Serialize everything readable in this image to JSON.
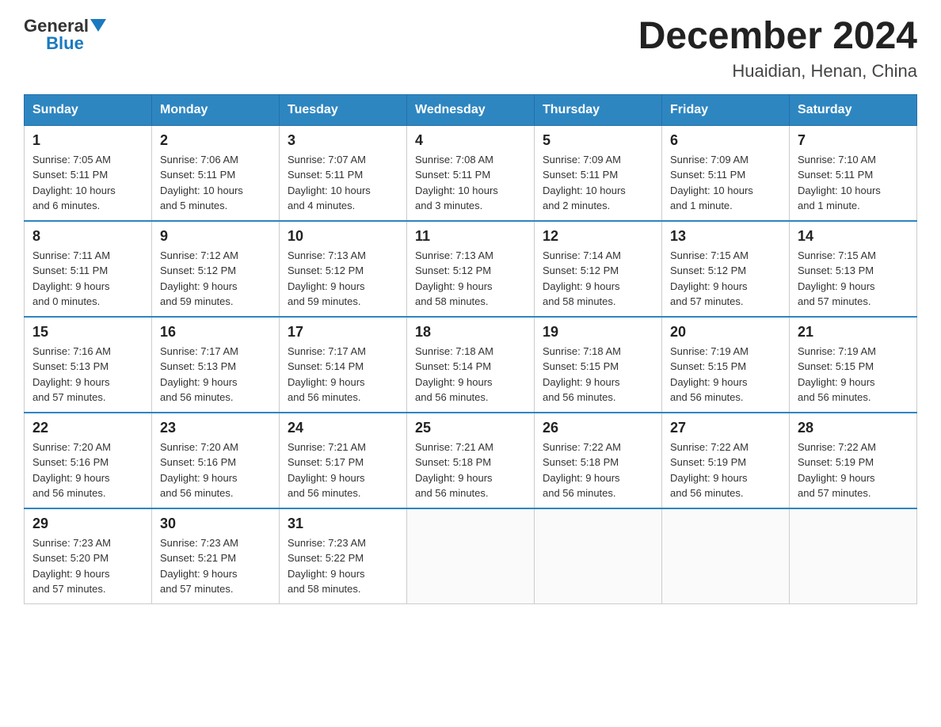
{
  "header": {
    "logo_general": "General",
    "logo_blue": "Blue",
    "title": "December 2024",
    "subtitle": "Huaidian, Henan, China"
  },
  "days_of_week": [
    "Sunday",
    "Monday",
    "Tuesday",
    "Wednesday",
    "Thursday",
    "Friday",
    "Saturday"
  ],
  "weeks": [
    [
      {
        "day": "1",
        "sunrise": "7:05 AM",
        "sunset": "5:11 PM",
        "daylight": "10 hours and 6 minutes."
      },
      {
        "day": "2",
        "sunrise": "7:06 AM",
        "sunset": "5:11 PM",
        "daylight": "10 hours and 5 minutes."
      },
      {
        "day": "3",
        "sunrise": "7:07 AM",
        "sunset": "5:11 PM",
        "daylight": "10 hours and 4 minutes."
      },
      {
        "day": "4",
        "sunrise": "7:08 AM",
        "sunset": "5:11 PM",
        "daylight": "10 hours and 3 minutes."
      },
      {
        "day": "5",
        "sunrise": "7:09 AM",
        "sunset": "5:11 PM",
        "daylight": "10 hours and 2 minutes."
      },
      {
        "day": "6",
        "sunrise": "7:09 AM",
        "sunset": "5:11 PM",
        "daylight": "10 hours and 1 minute."
      },
      {
        "day": "7",
        "sunrise": "7:10 AM",
        "sunset": "5:11 PM",
        "daylight": "10 hours and 1 minute."
      }
    ],
    [
      {
        "day": "8",
        "sunrise": "7:11 AM",
        "sunset": "5:11 PM",
        "daylight": "9 hours and 0 minutes."
      },
      {
        "day": "9",
        "sunrise": "7:12 AM",
        "sunset": "5:12 PM",
        "daylight": "9 hours and 59 minutes."
      },
      {
        "day": "10",
        "sunrise": "7:13 AM",
        "sunset": "5:12 PM",
        "daylight": "9 hours and 59 minutes."
      },
      {
        "day": "11",
        "sunrise": "7:13 AM",
        "sunset": "5:12 PM",
        "daylight": "9 hours and 58 minutes."
      },
      {
        "day": "12",
        "sunrise": "7:14 AM",
        "sunset": "5:12 PM",
        "daylight": "9 hours and 58 minutes."
      },
      {
        "day": "13",
        "sunrise": "7:15 AM",
        "sunset": "5:12 PM",
        "daylight": "9 hours and 57 minutes."
      },
      {
        "day": "14",
        "sunrise": "7:15 AM",
        "sunset": "5:13 PM",
        "daylight": "9 hours and 57 minutes."
      }
    ],
    [
      {
        "day": "15",
        "sunrise": "7:16 AM",
        "sunset": "5:13 PM",
        "daylight": "9 hours and 57 minutes."
      },
      {
        "day": "16",
        "sunrise": "7:17 AM",
        "sunset": "5:13 PM",
        "daylight": "9 hours and 56 minutes."
      },
      {
        "day": "17",
        "sunrise": "7:17 AM",
        "sunset": "5:14 PM",
        "daylight": "9 hours and 56 minutes."
      },
      {
        "day": "18",
        "sunrise": "7:18 AM",
        "sunset": "5:14 PM",
        "daylight": "9 hours and 56 minutes."
      },
      {
        "day": "19",
        "sunrise": "7:18 AM",
        "sunset": "5:15 PM",
        "daylight": "9 hours and 56 minutes."
      },
      {
        "day": "20",
        "sunrise": "7:19 AM",
        "sunset": "5:15 PM",
        "daylight": "9 hours and 56 minutes."
      },
      {
        "day": "21",
        "sunrise": "7:19 AM",
        "sunset": "5:15 PM",
        "daylight": "9 hours and 56 minutes."
      }
    ],
    [
      {
        "day": "22",
        "sunrise": "7:20 AM",
        "sunset": "5:16 PM",
        "daylight": "9 hours and 56 minutes."
      },
      {
        "day": "23",
        "sunrise": "7:20 AM",
        "sunset": "5:16 PM",
        "daylight": "9 hours and 56 minutes."
      },
      {
        "day": "24",
        "sunrise": "7:21 AM",
        "sunset": "5:17 PM",
        "daylight": "9 hours and 56 minutes."
      },
      {
        "day": "25",
        "sunrise": "7:21 AM",
        "sunset": "5:18 PM",
        "daylight": "9 hours and 56 minutes."
      },
      {
        "day": "26",
        "sunrise": "7:22 AM",
        "sunset": "5:18 PM",
        "daylight": "9 hours and 56 minutes."
      },
      {
        "day": "27",
        "sunrise": "7:22 AM",
        "sunset": "5:19 PM",
        "daylight": "9 hours and 56 minutes."
      },
      {
        "day": "28",
        "sunrise": "7:22 AM",
        "sunset": "5:19 PM",
        "daylight": "9 hours and 57 minutes."
      }
    ],
    [
      {
        "day": "29",
        "sunrise": "7:23 AM",
        "sunset": "5:20 PM",
        "daylight": "9 hours and 57 minutes."
      },
      {
        "day": "30",
        "sunrise": "7:23 AM",
        "sunset": "5:21 PM",
        "daylight": "9 hours and 57 minutes."
      },
      {
        "day": "31",
        "sunrise": "7:23 AM",
        "sunset": "5:22 PM",
        "daylight": "9 hours and 58 minutes."
      },
      null,
      null,
      null,
      null
    ]
  ],
  "labels": {
    "sunrise": "Sunrise:",
    "sunset": "Sunset:",
    "daylight": "Daylight:"
  }
}
